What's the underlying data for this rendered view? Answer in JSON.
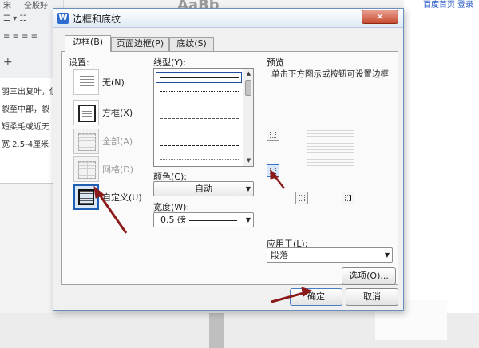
{
  "background": {
    "ribbon_text_1": "宋",
    "ribbon_text_2": "仝股好",
    "ribbon_text_3": "AaBb",
    "doc_lines": [
      "羽三出复叶，俱",
      "裂至中部，裂",
      "短柔毛或近无",
      "宽 2.5-4厘米"
    ],
    "top_links": "百度首页  登录"
  },
  "dialog": {
    "title": "边框和底纹",
    "close_label": "✕",
    "tabs": [
      {
        "label": "边框(B)",
        "active": true
      },
      {
        "label": "页面边框(P)",
        "active": false
      },
      {
        "label": "底纹(S)",
        "active": false
      }
    ]
  },
  "setting": {
    "label": "设置:",
    "options": [
      {
        "label": "无(N)",
        "enabled": true,
        "selected": false
      },
      {
        "label": "方框(X)",
        "enabled": true,
        "selected": false
      },
      {
        "label": "全部(A)",
        "enabled": false,
        "selected": false
      },
      {
        "label": "网格(D)",
        "enabled": false,
        "selected": false
      },
      {
        "label": "自定义(U)",
        "enabled": true,
        "selected": true
      }
    ]
  },
  "line_style": {
    "label": "线型(Y):",
    "styles": [
      "solid",
      "dotted",
      "dashed",
      "dash-dot",
      "dash-dot-dot",
      "long-dash",
      "dotted-fine"
    ]
  },
  "color": {
    "label": "颜色(C):",
    "value": "自动"
  },
  "width": {
    "label": "宽度(W):",
    "value": "0.5  磅"
  },
  "preview": {
    "label": "预览",
    "hint": "单击下方图示或按钮可设置边框"
  },
  "apply_to": {
    "label": "应用于(L):",
    "value": "段落"
  },
  "buttons": {
    "options": "选项(O)...",
    "ok": "确定",
    "cancel": "取消"
  },
  "colors": {
    "accent": "#1c5fb3",
    "arrow": "#8b1a1a",
    "close": "#c84a30"
  }
}
